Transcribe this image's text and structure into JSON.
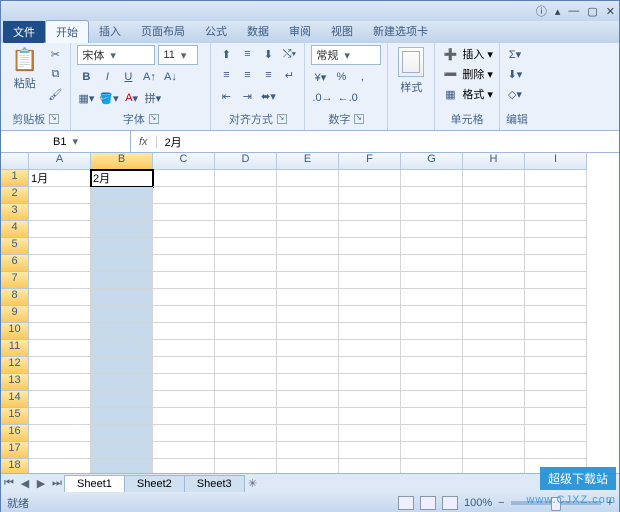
{
  "menu": {
    "file": "文件",
    "tabs": [
      "开始",
      "插入",
      "页面布局",
      "公式",
      "数据",
      "审阅",
      "视图",
      "新建选项卡"
    ],
    "active": 0
  },
  "ribbon": {
    "clipboard": {
      "paste": "粘贴",
      "label": "剪贴板"
    },
    "font": {
      "name": "宋体",
      "size": "11",
      "label": "字体"
    },
    "align": {
      "label": "对齐方式"
    },
    "number": {
      "format": "常规",
      "label": "数字"
    },
    "styles": {
      "btn": "样式",
      "label": ""
    },
    "cells": {
      "insert": "插入",
      "delete": "删除",
      "format": "格式",
      "label": "单元格"
    },
    "editing": {
      "label": "编辑"
    }
  },
  "namebox": "B1",
  "formula": "2月",
  "columns": [
    "A",
    "B",
    "C",
    "D",
    "E",
    "F",
    "G",
    "H",
    "I"
  ],
  "rows": 19,
  "cells": {
    "A1": "1月",
    "B1": "2月"
  },
  "selection": {
    "col": "B",
    "activeRow": 1,
    "rangeRows": [
      1,
      19
    ]
  },
  "sheets": [
    "Sheet1",
    "Sheet2",
    "Sheet3"
  ],
  "activeSheet": 0,
  "status": {
    "ready": "就绪",
    "zoom": "100%"
  },
  "watermark": {
    "t1": "超级下载站",
    "t2": "www.CJXZ.com"
  }
}
